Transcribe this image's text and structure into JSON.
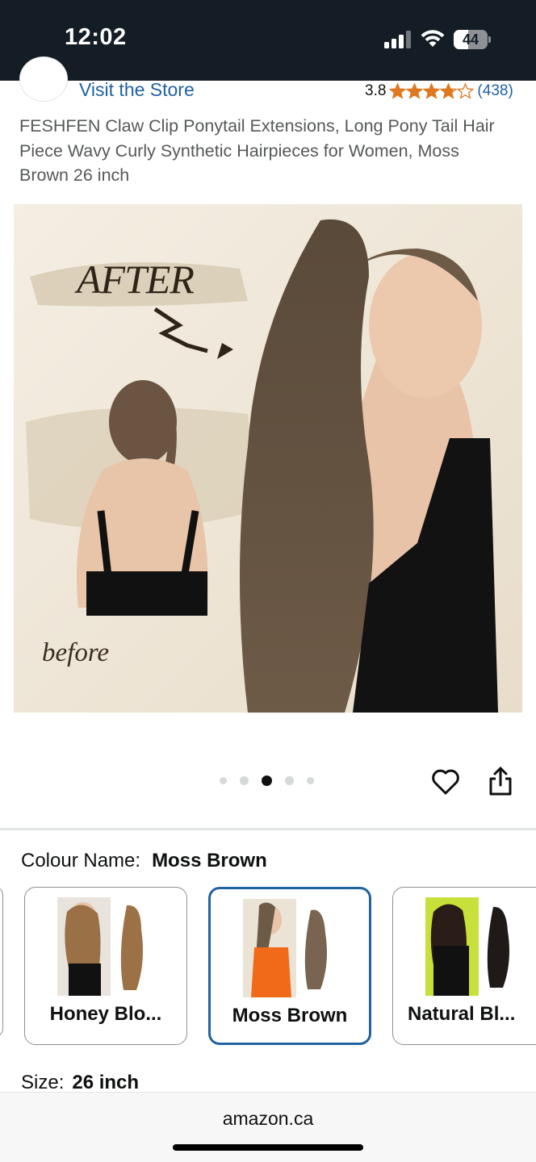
{
  "status_bar": {
    "time": "12:02",
    "battery": "44",
    "battery_level_percent": 44
  },
  "store": {
    "link_label": "Visit the Store"
  },
  "rating": {
    "value": "3.8",
    "stars": 3.8,
    "count": "(438)"
  },
  "product": {
    "title": "FESHFEN Claw Clip Ponytail Extensions, Long Pony Tail Hair Piece Wavy Curly Synthetic Hairpieces for Women, Moss Brown 26 inch"
  },
  "image": {
    "after_label": "AFTER",
    "before_label": "before"
  },
  "carousel": {
    "total": 5,
    "active_index": 2
  },
  "colour": {
    "label": "Colour Name:",
    "value": "Moss Brown",
    "options": [
      {
        "label": "Honey Blo...",
        "selected": false
      },
      {
        "label": "Moss Brown",
        "selected": true
      },
      {
        "label": "Natural Bl...",
        "selected": false
      }
    ]
  },
  "size": {
    "label": "Size:",
    "value": "26 inch"
  },
  "browser": {
    "domain": "amazon.ca"
  },
  "colors": {
    "link": "#2162a1",
    "star": "#de7921",
    "selected_border": "#2162a1",
    "status_bar": "#141d25"
  }
}
